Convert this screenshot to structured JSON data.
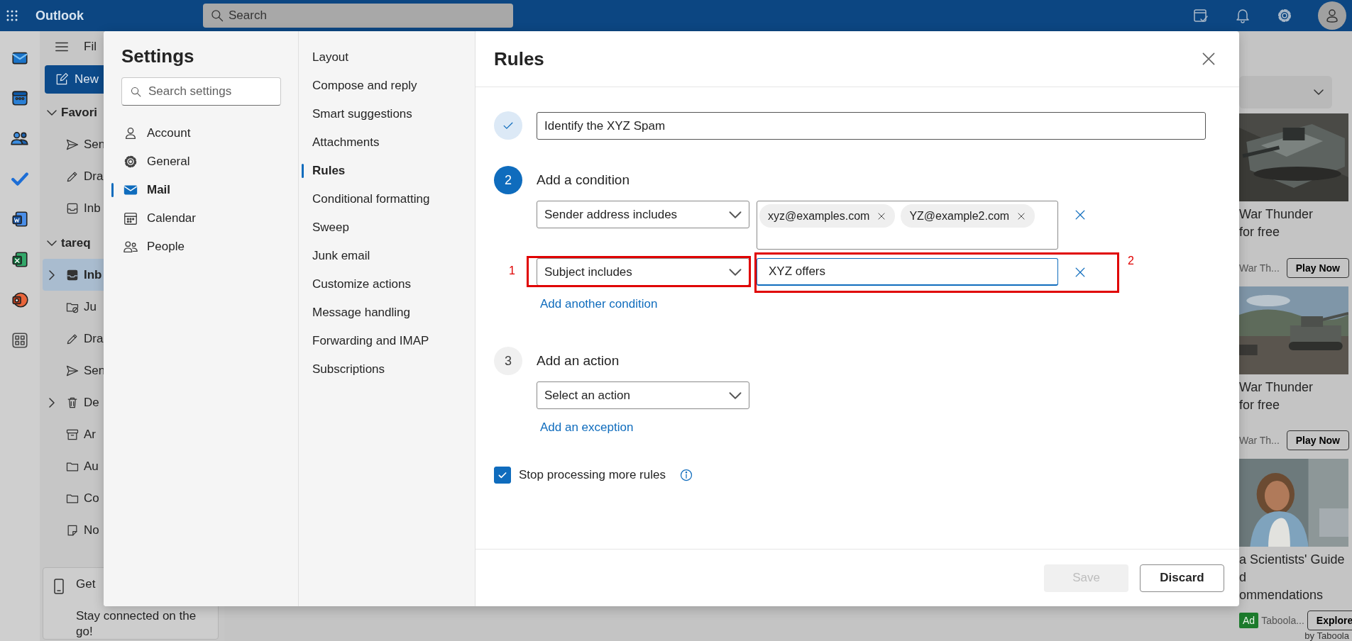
{
  "app_bar": {
    "title": "Outlook",
    "search": {
      "placeholder": "Search"
    }
  },
  "mail_pane": {
    "menu_fragment": "Fil",
    "new_button": "New",
    "folders": [
      {
        "label": "Favori",
        "kind": "group",
        "expanded": true,
        "selected": false
      },
      {
        "label": "Sen",
        "kind": "sent",
        "selected": false
      },
      {
        "label": "Dra",
        "kind": "drafts",
        "selected": false
      },
      {
        "label": "Inb",
        "kind": "inbox",
        "selected": false
      },
      {
        "label": "tareq",
        "kind": "group",
        "expanded": true,
        "selected": false
      },
      {
        "label": "Inb",
        "kind": "inbox",
        "expanded": false,
        "selected": true
      },
      {
        "label": "Ju",
        "kind": "junk",
        "selected": false
      },
      {
        "label": "Dra",
        "kind": "drafts",
        "selected": false
      },
      {
        "label": "Sen",
        "kind": "sent",
        "selected": false
      },
      {
        "label": "De",
        "kind": "deleted",
        "expanded": false,
        "selected": false
      },
      {
        "label": "Ar",
        "kind": "archive",
        "selected": false
      },
      {
        "label": "Au",
        "kind": "folder",
        "selected": false
      },
      {
        "label": "Co",
        "kind": "folder",
        "selected": false
      },
      {
        "label": "No",
        "kind": "notes",
        "selected": false
      }
    ],
    "promo": {
      "lines": [
        "Get",
        "Stay connected on the",
        "go!"
      ]
    }
  },
  "ads": {
    "items": [
      {
        "title_lines": [
          "War Thunder",
          "for free"
        ],
        "source": "War Th...",
        "button": "Play Now"
      },
      {
        "title_lines": [
          "War Thunder",
          "for free"
        ],
        "source": "War Th...",
        "button": "Play Now"
      },
      {
        "title_lines": [
          "a Scientists' Guide",
          "d",
          "ommendations"
        ],
        "badge": "Ad",
        "source": "Taboola...",
        "button": "Explore"
      }
    ],
    "attribution": "by Taboola"
  },
  "settings": {
    "title": "Settings",
    "search": {
      "placeholder": "Search settings"
    },
    "nav": [
      {
        "label": "Account",
        "kind": "account",
        "selected": false
      },
      {
        "label": "General",
        "kind": "general",
        "selected": false
      },
      {
        "label": "Mail",
        "kind": "mail",
        "selected": true
      },
      {
        "label": "Calendar",
        "kind": "calendar",
        "selected": false
      },
      {
        "label": "People",
        "kind": "people",
        "selected": false
      }
    ],
    "subnav": [
      {
        "label": "Layout",
        "selected": false
      },
      {
        "label": "Compose and reply",
        "selected": false
      },
      {
        "label": "Smart suggestions",
        "selected": false
      },
      {
        "label": "Attachments",
        "selected": false
      },
      {
        "label": "Rules",
        "selected": true
      },
      {
        "label": "Conditional formatting",
        "selected": false
      },
      {
        "label": "Sweep",
        "selected": false
      },
      {
        "label": "Junk email",
        "selected": false
      },
      {
        "label": "Customize actions",
        "selected": false
      },
      {
        "label": "Message handling",
        "selected": false
      },
      {
        "label": "Forwarding and IMAP",
        "selected": false
      },
      {
        "label": "Subscriptions",
        "selected": false
      }
    ]
  },
  "rules": {
    "title": "Rules",
    "steps": [
      {
        "kind": "done",
        "value": "Identify the XYZ Spam"
      },
      {
        "kind": "active",
        "number": "2",
        "title": "Add a condition",
        "conditions": [
          {
            "field": "Sender address includes",
            "kind": "tags",
            "tags": [
              "xyz@examples.com",
              "YZ@example2.com"
            ]
          },
          {
            "field": "Subject includes",
            "kind": "text",
            "value": "XYZ offers",
            "field_annotation": "1",
            "value_annotation": "2"
          }
        ],
        "link": "Add another condition"
      },
      {
        "kind": "pending",
        "number": "3",
        "title": "Add an action",
        "dropdown": "Select an action",
        "link": "Add an exception"
      }
    ],
    "stop_processing": {
      "label": "Stop processing more rules",
      "checked": true
    },
    "buttons": [
      {
        "label": "Save",
        "kind": "primary",
        "disabled": true
      },
      {
        "label": "Discard",
        "kind": "secondary",
        "disabled": false
      }
    ]
  }
}
